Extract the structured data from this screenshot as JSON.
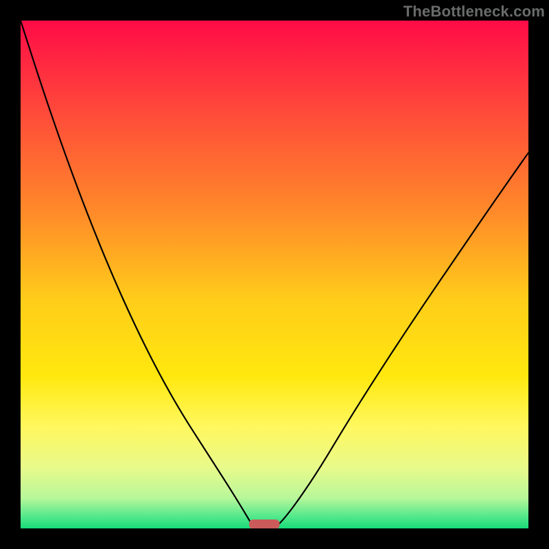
{
  "watermark": "TheBottleneck.com",
  "chart_data": {
    "type": "line",
    "title": "",
    "xlabel": "",
    "ylabel": "",
    "xlim": [
      0,
      100
    ],
    "ylim": [
      0,
      100
    ],
    "background_gradient": {
      "stops": [
        {
          "offset": 0.0,
          "color": "#ff0b47"
        },
        {
          "offset": 0.18,
          "color": "#ff4a3a"
        },
        {
          "offset": 0.38,
          "color": "#ff8b29"
        },
        {
          "offset": 0.55,
          "color": "#ffcd1a"
        },
        {
          "offset": 0.7,
          "color": "#ffe80e"
        },
        {
          "offset": 0.8,
          "color": "#fff85f"
        },
        {
          "offset": 0.88,
          "color": "#e8fa8a"
        },
        {
          "offset": 0.94,
          "color": "#b8f79a"
        },
        {
          "offset": 0.975,
          "color": "#57e98c"
        },
        {
          "offset": 1.0,
          "color": "#17db78"
        }
      ]
    },
    "series": [
      {
        "name": "left-curve",
        "x": [
          0.0,
          4.5,
          9.0,
          13.5,
          18.0,
          22.5,
          27.0,
          31.5,
          36.0,
          40.5,
          43.0,
          44.8,
          46.0
        ],
        "y": [
          100.0,
          86.0,
          73.0,
          61.0,
          50.0,
          40.0,
          31.0,
          23.0,
          16.0,
          9.0,
          5.0,
          2.0,
          0.0
        ]
      },
      {
        "name": "right-curve",
        "x": [
          50.0,
          52.0,
          55.0,
          59.0,
          63.5,
          68.5,
          74.0,
          80.0,
          86.5,
          93.0,
          100.0
        ],
        "y": [
          0.0,
          2.0,
          6.0,
          12.0,
          19.5,
          27.5,
          36.0,
          45.0,
          54.5,
          64.0,
          74.0
        ]
      }
    ],
    "marker": {
      "name": "optimal-zone-marker",
      "x_center": 48.0,
      "width": 6.0,
      "color": "#cb5b5b"
    }
  }
}
